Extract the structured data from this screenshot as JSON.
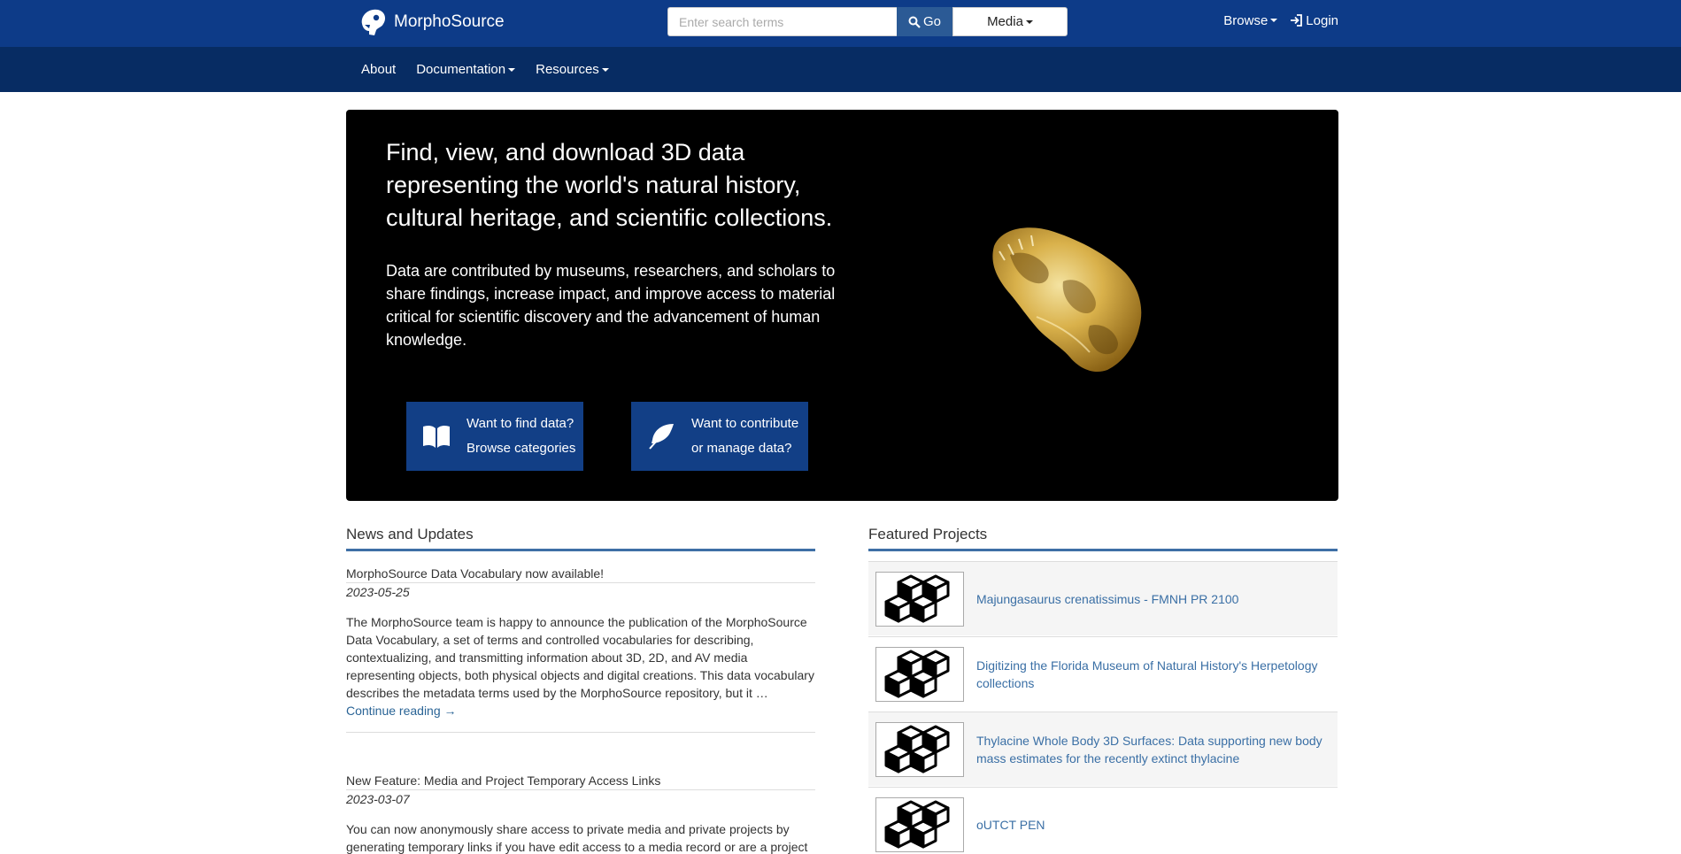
{
  "brand": {
    "name": "MorphoSource"
  },
  "search": {
    "placeholder": "Enter search terms",
    "go_label": "Go",
    "scope_label": "Media"
  },
  "top_nav": {
    "browse_label": "Browse",
    "login_label": "Login"
  },
  "sub_nav": {
    "items": [
      "About",
      "Documentation",
      "Resources"
    ]
  },
  "hero": {
    "title": "Find, view, and download 3D data representing the world's natural history, cultural heritage, and scientific collections.",
    "text": "Data are contributed by museums, researchers, and scholars to share findings, increase impact, and improve access to material critical for scientific discovery and the advancement of human knowledge.",
    "find_btn": {
      "line1": "Want to find data?",
      "line2": "Browse categories"
    },
    "contribute_btn": {
      "line1": "Want to contribute",
      "line2": "or manage data?"
    }
  },
  "news": {
    "heading": "News and Updates",
    "items": [
      {
        "title": "MorphoSource Data Vocabulary now available!",
        "date": "2023-05-25",
        "body": "The MorphoSource team is happy to announce the publication of the MorphoSource Data Vocabulary, a set of terms and controlled vocabularies for describing, contextualizing, and transmitting information about 3D, 2D, and AV media representing objects, both physical objects and digital creations. This data vocabulary describes the metadata terms used by the MorphoSource repository, but it …",
        "link": "Continue reading →"
      },
      {
        "title": "New Feature: Media and Project Temporary Access Links",
        "date": "2023-03-07",
        "body": "You can now anonymously share access to private media and private projects by generating temporary links if you have edit access to a media record or are a project"
      }
    ]
  },
  "projects": {
    "heading": "Featured Projects",
    "items": [
      "Majungasaurus crenatissimus - FMNH PR 2100",
      "Digitizing the Florida Museum of Natural History's Herpetology collections",
      "Thylacine Whole Body 3D Surfaces: Data supporting new body mass estimates for the recently extinct thylacine",
      "oUTCT PEN"
    ]
  },
  "colors": {
    "navbar": "#0d3b88",
    "subnav": "#072c63",
    "hero_button": "#123f86",
    "link": "#3a6fa5"
  }
}
